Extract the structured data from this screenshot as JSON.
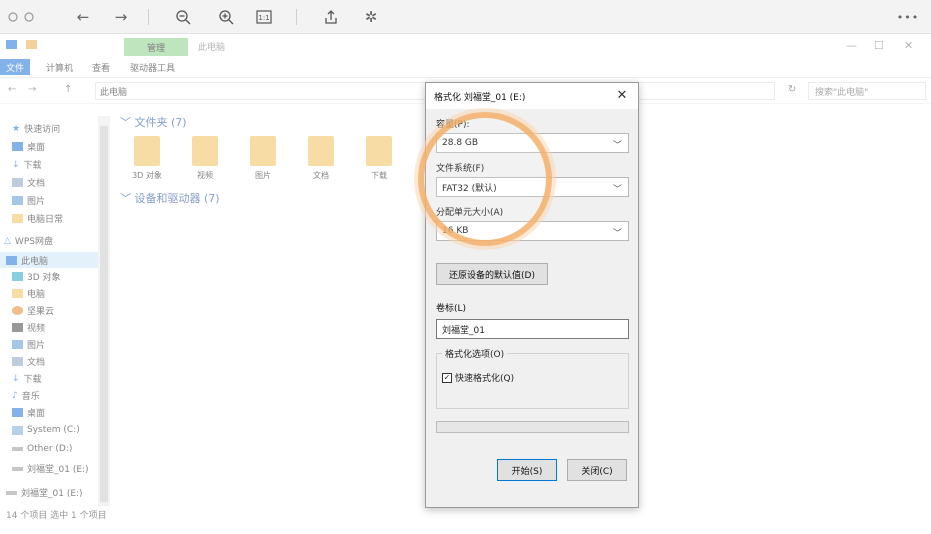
{
  "viewer": {
    "back_icon": "arrow-left-icon",
    "forward_icon": "arrow-right-icon",
    "zoom_out_icon": "zoom-out-icon",
    "zoom_in_icon": "zoom-in-icon",
    "fit_icon": "fit-icon",
    "rotate_icon": "rotate-icon",
    "magic_icon": "magic-wand-icon",
    "more_label": "•••"
  },
  "explorer": {
    "manage_tab": "管理",
    "window_title": "此电脑",
    "ribbon_tabs": [
      "文件",
      "计算机",
      "查看",
      "驱动器工具"
    ],
    "address": "此电脑",
    "search_placeholder": "搜索\"此电脑\"",
    "nav_items": [
      "快速访问",
      "桌面",
      "下载",
      "文档",
      "图片",
      "电脑日常",
      "WPS网盘",
      "此电脑",
      "3D 对象",
      "电脑",
      "坚果云",
      "视频",
      "图片",
      "文档",
      "下载",
      "音乐",
      "桌面",
      "System (C:)",
      "Other (D:)",
      "刘福堂_01 (E:)",
      "刘福堂_01 (E:)"
    ],
    "folders_header": "文件夹 (7)",
    "folders": [
      "3D 对象",
      "视频",
      "图片",
      "文档",
      "下载"
    ],
    "devices_header": "设备和驱动器 (7)",
    "status": "14 个项目    选中 1 个项目"
  },
  "dialog": {
    "title": "格式化 刘福堂_01 (E:)",
    "capacity_label": "容量(P):",
    "capacity_value": "28.8 GB",
    "filesystem_label": "文件系统(F)",
    "filesystem_value": "FAT32 (默认)",
    "alloc_label": "分配单元大小(A)",
    "alloc_value": "16 KB",
    "restore_button": "还原设备的默认值(D)",
    "volume_label": "卷标(L)",
    "volume_value": "刘福堂_01",
    "options_legend": "格式化选项(O)",
    "quick_format": "快速格式化(Q)",
    "quick_format_checked": true,
    "start_button": "开始(S)",
    "close_button": "关闭(C)"
  },
  "colors": {
    "highlight": "#f5af69",
    "manage_tab": "#8bd18b",
    "accent": "#1e73d8"
  }
}
